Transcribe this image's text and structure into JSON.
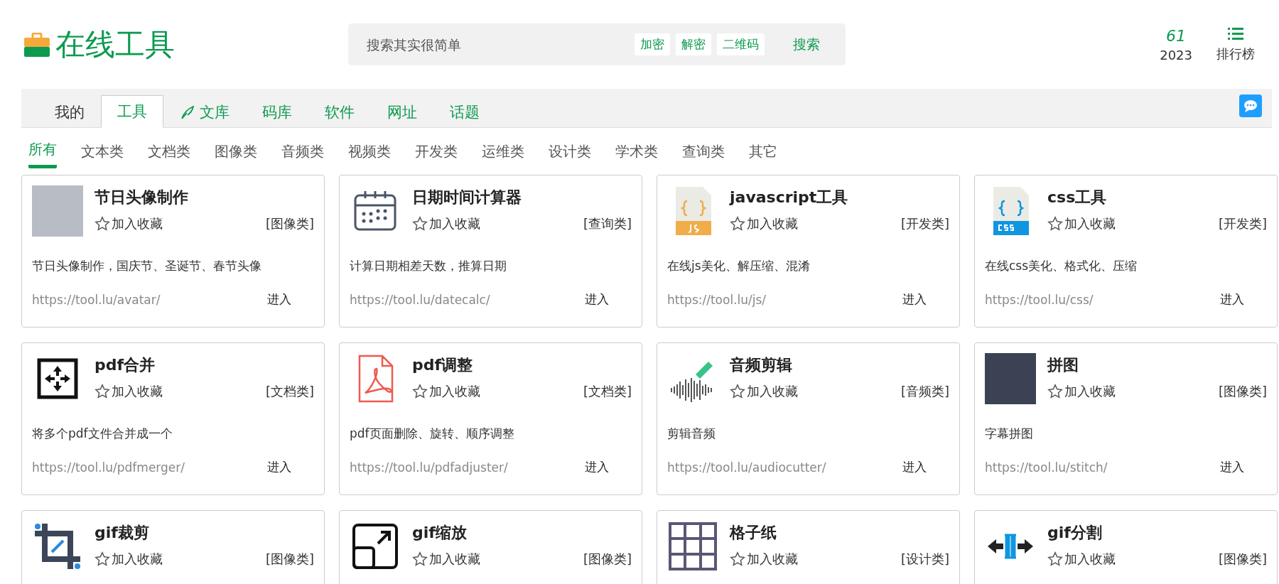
{
  "logo": {
    "title": "在线工具"
  },
  "search": {
    "placeholder": "搜索其实很简单",
    "quick_links": [
      "加密",
      "解密",
      "二维码"
    ],
    "button": "搜索"
  },
  "stats": {
    "count": "61",
    "year": "2023"
  },
  "ranking": {
    "label": "排行榜"
  },
  "tabs": [
    {
      "label": "我的",
      "selected": false,
      "kind": "muted"
    },
    {
      "label": "工具",
      "selected": true,
      "kind": "plain"
    },
    {
      "label": "文库",
      "selected": false,
      "kind": "feather"
    },
    {
      "label": "码库",
      "selected": false,
      "kind": "plain"
    },
    {
      "label": "软件",
      "selected": false,
      "kind": "plain"
    },
    {
      "label": "网址",
      "selected": false,
      "kind": "plain"
    },
    {
      "label": "话题",
      "selected": false,
      "kind": "plain"
    }
  ],
  "categories": [
    {
      "label": "所有",
      "selected": true
    },
    {
      "label": "文本类",
      "selected": false
    },
    {
      "label": "文档类",
      "selected": false
    },
    {
      "label": "图像类",
      "selected": false
    },
    {
      "label": "音频类",
      "selected": false
    },
    {
      "label": "视频类",
      "selected": false
    },
    {
      "label": "开发类",
      "selected": false
    },
    {
      "label": "运维类",
      "selected": false
    },
    {
      "label": "设计类",
      "selected": false
    },
    {
      "label": "学术类",
      "selected": false
    },
    {
      "label": "查询类",
      "selected": false
    },
    {
      "label": "其它",
      "selected": false
    }
  ],
  "cards": [
    {
      "title": "节日头像制作",
      "favorite": "加入收藏",
      "category": "[图像类]",
      "description": "节日头像制作，国庆节、圣诞节、春节头像",
      "url": "https://tool.lu/avatar/",
      "enter": "进入"
    },
    {
      "title": "日期时间计算器",
      "favorite": "加入收藏",
      "category": "[查询类]",
      "description": "计算日期相差天数，推算日期",
      "url": "https://tool.lu/datecalc/",
      "enter": "进入"
    },
    {
      "title": "javascript工具",
      "favorite": "加入收藏",
      "category": "[开发类]",
      "description": "在线js美化、解压缩、混淆",
      "url": "https://tool.lu/js/",
      "enter": "进入"
    },
    {
      "title": "css工具",
      "favorite": "加入收藏",
      "category": "[开发类]",
      "description": "在线css美化、格式化、压缩",
      "url": "https://tool.lu/css/",
      "enter": "进入"
    },
    {
      "title": "pdf合并",
      "favorite": "加入收藏",
      "category": "[文档类]",
      "description": "将多个pdf文件合并成一个",
      "url": "https://tool.lu/pdfmerger/",
      "enter": "进入"
    },
    {
      "title": "pdf调整",
      "favorite": "加入收藏",
      "category": "[文档类]",
      "description": "pdf页面删除、旋转、顺序调整",
      "url": "https://tool.lu/pdfadjuster/",
      "enter": "进入"
    },
    {
      "title": "音频剪辑",
      "favorite": "加入收藏",
      "category": "[音频类]",
      "description": "剪辑音频",
      "url": "https://tool.lu/audiocutter/",
      "enter": "进入"
    },
    {
      "title": "拼图",
      "favorite": "加入收藏",
      "category": "[图像类]",
      "description": "字幕拼图",
      "url": "https://tool.lu/stitch/",
      "enter": "进入"
    },
    {
      "title": "gif裁剪",
      "favorite": "加入收藏",
      "category": "[图像类]"
    },
    {
      "title": "gif缩放",
      "favorite": "加入收藏",
      "category": "[图像类]"
    },
    {
      "title": "格子纸",
      "favorite": "加入收藏",
      "category": "[设计类]"
    },
    {
      "title": "gif分割",
      "favorite": "加入收藏",
      "category": "[图像类]"
    }
  ]
}
